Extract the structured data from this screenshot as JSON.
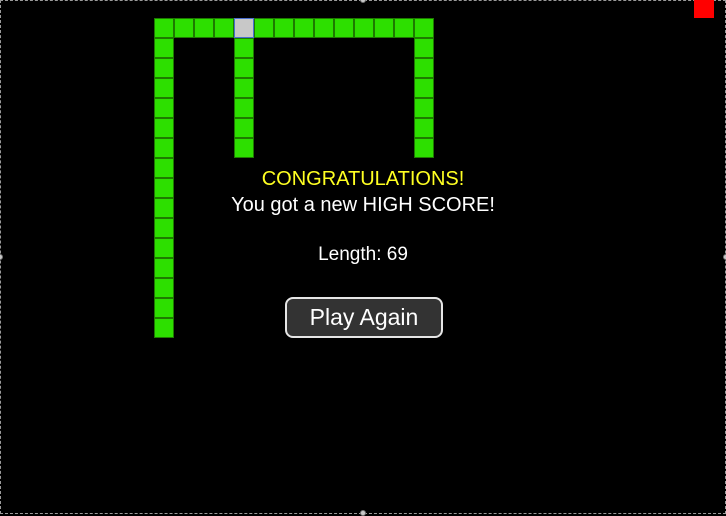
{
  "game": {
    "congrats": "CONGRATULATIONS!",
    "high_score_message": "You got a new HIGH SCORE!",
    "length_label": "Length:",
    "length_value": "69",
    "play_again_label": "Play Again"
  },
  "colors": {
    "background": "#000000",
    "snake_body": "#2ddf00",
    "snake_head": "#c8c8c8",
    "food": "#ff0000",
    "congrats_text": "#ffff22",
    "message_text": "#ffffff"
  }
}
